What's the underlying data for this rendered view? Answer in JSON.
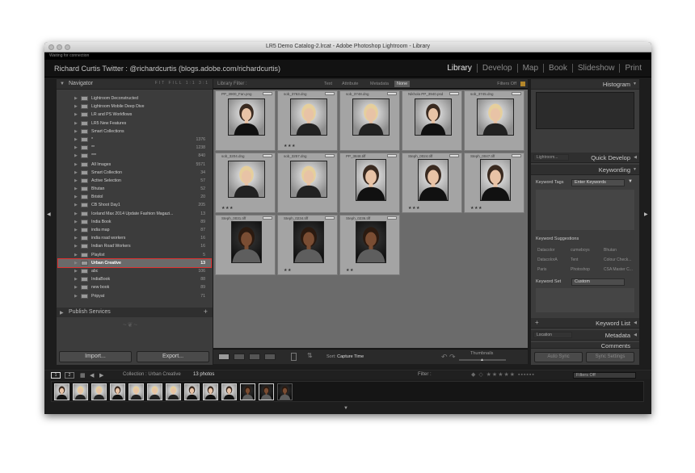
{
  "window": {
    "title": "LR5 Demo Catalog-2.lrcat - Adobe Photoshop Lightroom - Library"
  },
  "status": {
    "text": "Waiting for connection"
  },
  "identity_plate": "Richard Curtis Twitter : @richardcurtis (blogs.adobe.com/richardcurtis)",
  "modules": [
    "Library",
    "Develop",
    "Map",
    "Book",
    "Slideshow",
    "Print"
  ],
  "active_module": "Library",
  "left_panel": {
    "navigator_label": "Navigator",
    "navigator_options": "FIT  FILL  1:1  3:1",
    "collections": [
      {
        "name": "Lightroom Deconstructed",
        "count": ""
      },
      {
        "name": "Lightroom Mobile Deep Dive",
        "count": ""
      },
      {
        "name": "LR and PS Workflows",
        "count": ""
      },
      {
        "name": "LR5 New Features",
        "count": ""
      },
      {
        "name": "Smart Collections",
        "count": ""
      },
      {
        "name": "*",
        "count": "1376"
      },
      {
        "name": "**",
        "count": "1238"
      },
      {
        "name": "***",
        "count": "840"
      },
      {
        "name": "All Images",
        "count": "5571"
      },
      {
        "name": "Smart Collection",
        "count": "34"
      },
      {
        "name": "Active Selection",
        "count": "57"
      },
      {
        "name": "Bhutan",
        "count": "52"
      },
      {
        "name": "Bristol",
        "count": "20"
      },
      {
        "name": "CB Shoot Day1",
        "count": "205"
      },
      {
        "name": "Iceland Max 2014 Update Fashion Magazi...",
        "count": "13"
      },
      {
        "name": "India Book",
        "count": "89"
      },
      {
        "name": "india map",
        "count": "87"
      },
      {
        "name": "india road workers",
        "count": "16"
      },
      {
        "name": "Indian Road Workers",
        "count": "16"
      },
      {
        "name": "Playlist",
        "count": "5"
      },
      {
        "name": "Urban Creative",
        "count": "13"
      },
      {
        "name": "abc",
        "count": "106"
      },
      {
        "name": "IndiaBook",
        "count": "88"
      },
      {
        "name": "new book",
        "count": "89"
      },
      {
        "name": "Pripyat",
        "count": "71"
      }
    ],
    "selected_collection": "Urban Creative",
    "publish_services_label": "Publish Services",
    "import_label": "Import...",
    "export_label": "Export..."
  },
  "filter_bar": {
    "label": "Library Filter :",
    "options": [
      "Text",
      "Attribute",
      "Metadata",
      "None"
    ],
    "active": "None",
    "filters_off": "Filters Off"
  },
  "grid": [
    {
      "file": "PP_3900_Fan.png",
      "stars": ""
    },
    {
      "file": "sob_3763.dng",
      "stars": "★★★"
    },
    {
      "file": "sob_3748.dng",
      "stars": ""
    },
    {
      "file": "Nikhola PP_3940.psd",
      "stars": ""
    },
    {
      "file": "sob_3745.dng",
      "stars": ""
    },
    {
      "file": "sob_3204.dng",
      "stars": "★★★"
    },
    {
      "file": "sob_3257.dng",
      "stars": ""
    },
    {
      "file": "PP_3848.tiff",
      "stars": ""
    },
    {
      "file": "Steph_0024.tiff",
      "stars": "★★★"
    },
    {
      "file": "Steph_0047.tiff",
      "stars": "★★★"
    },
    {
      "file": "Steph_0031.tiff",
      "stars": ""
    },
    {
      "file": "Steph_0234.tiff",
      "stars": "★★"
    },
    {
      "file": "Steph_0236.tiff",
      "stars": "★★"
    }
  ],
  "toolbar": {
    "sort_label": "Sort:",
    "sort_value": "Capture Time",
    "thumbnails_label": "Thumbnails"
  },
  "right_panel": {
    "histogram_label": "Histogram",
    "lightroom_label": "Lightroom...",
    "quick_develop_label": "Quick Develop",
    "keywording_label": "Keywording",
    "keyword_tags_label": "Keyword Tags",
    "keyword_tags_value": "Enter Keywords",
    "keyword_suggestions_label": "Keyword Suggestions",
    "suggestions": [
      "Datacolor",
      "cumwboys",
      "Bhutan",
      "DatacolorA",
      "Tent",
      "Colour Check...",
      "Paris",
      "Photoshop",
      "CSA Master C..."
    ],
    "keyword_set_label": "Keyword Set",
    "keyword_set_value": "Custom",
    "keyword_list_label": "Keyword List",
    "location_label": "Location",
    "metadata_label": "Metadata",
    "comments_label": "Comments",
    "auto_sync_label": "Auto Sync",
    "sync_settings_label": "Sync Settings"
  },
  "filmstrip": {
    "screen1": "1",
    "screen2": "2",
    "source": "Collection : Urban Creative",
    "count": "13 photos",
    "filter_label": "Filter :",
    "filters_off": "Filters Off"
  }
}
